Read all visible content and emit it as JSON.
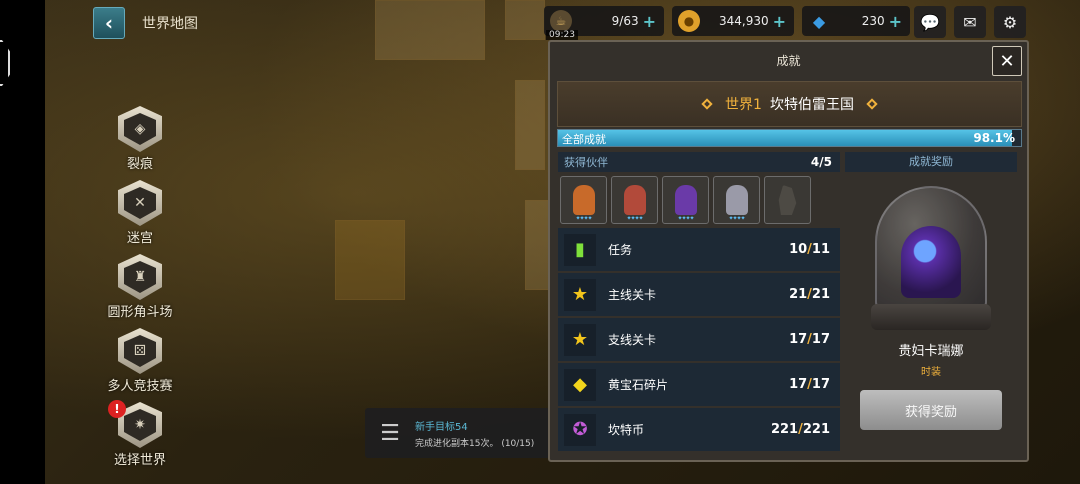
{
  "map": {
    "title": "世界地图",
    "timer": "09:23",
    "resources": [
      {
        "id": "stamina",
        "icon": "coffee-icon",
        "value": "9/63",
        "color": "#c7a25a"
      },
      {
        "id": "gold",
        "icon": "coin-icon",
        "value": "344,930",
        "color": "#e0a12b"
      },
      {
        "id": "gems",
        "icon": "gem-icon",
        "value": "230",
        "color": "#3b9be3"
      }
    ],
    "plus": "+"
  },
  "nav": {
    "items": [
      {
        "label": "裂痕",
        "glyph": "◈"
      },
      {
        "label": "迷宫",
        "glyph": "✕"
      },
      {
        "label": "圆形角斗场",
        "glyph": "♜"
      },
      {
        "label": "多人竞技赛",
        "glyph": "⚄"
      },
      {
        "label": "选择世界",
        "glyph": "✷"
      }
    ],
    "alert": "!"
  },
  "quest": {
    "menu_glyph": "☰",
    "title": "新手目标54",
    "desc": "完成进化副本15次。 (10/15)"
  },
  "modal": {
    "title": "成就",
    "close_glyph": "✕",
    "world_name": "世界1",
    "world_title": "坎特伯雷王国",
    "progress_label": "全部成就",
    "progress_pct": "98.1%",
    "progress_value": 0.981,
    "partners_label": "获得伙伴",
    "partners_count": "4/5",
    "partners": [
      {
        "color": "#c86a2a",
        "stars": "✦✦✦✦"
      },
      {
        "color": "#b24a3a",
        "stars": "✦✦✦✦"
      },
      {
        "color": "#6a3aa8",
        "stars": "✦✦✦✦"
      },
      {
        "color": "#9a9aa8",
        "stars": "✦✦✦✦"
      }
    ],
    "achievements": [
      {
        "label": "任务",
        "cur": "10",
        "total": "11",
        "icon": "bookmark-icon",
        "glyph": "▮",
        "color": "#7fe03b"
      },
      {
        "label": "主线关卡",
        "cur": "21",
        "total": "21",
        "icon": "stars-icon",
        "glyph": "★",
        "color": "#f3c51c"
      },
      {
        "label": "支线关卡",
        "cur": "17",
        "total": "17",
        "icon": "star-icon",
        "glyph": "★",
        "color": "#f3c51c"
      },
      {
        "label": "黄宝石碎片",
        "cur": "17",
        "total": "17",
        "icon": "gem-cube-icon",
        "glyph": "◆",
        "color": "#f3d51c"
      },
      {
        "label": "坎特币",
        "cur": "221",
        "total": "221",
        "icon": "kanter-coin-icon",
        "glyph": "✪",
        "color": "#c25bd6"
      }
    ],
    "reward_label": "成就奖励",
    "reward_name": "贵妇卡瑞娜",
    "reward_type": "时装",
    "reward_button": "获得奖励"
  }
}
